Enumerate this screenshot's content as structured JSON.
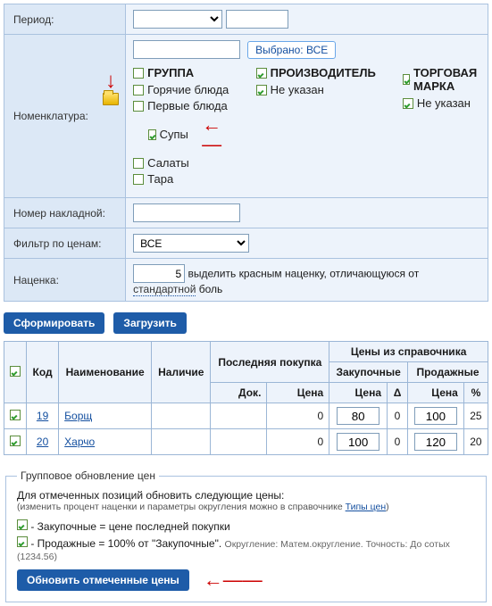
{
  "form": {
    "period_label": "Период:",
    "nomen_label": "Номенклатура:",
    "invoice_label": "Номер накладной:",
    "filter_label": "Фильтр по ценам:",
    "markup_label": "Наценка:",
    "selected_all_btn": "Выбрано: ВСЕ",
    "filter_value": "ВСЕ",
    "markup_value": "5",
    "markup_hint_prefix": "выделить красным наценку, отличающуюся от ",
    "markup_hint_link": "стандартной",
    "markup_hint_suffix": " боль"
  },
  "tree": {
    "col1_header": "ГРУППА",
    "col2_header": "ПРОИЗВОДИТЕЛЬ",
    "col3_header": "ТОРГОВАЯ МАРКА",
    "not_specified": "Не указан",
    "items": {
      "hot": "Горячие блюда",
      "first": "Первые блюда",
      "soups": "Супы",
      "salads": "Салаты",
      "tara": "Тара"
    }
  },
  "buttons": {
    "generate": "Сформировать",
    "load": "Загрузить",
    "update_prices": "Обновить отмеченные цены"
  },
  "table": {
    "h_code": "Код",
    "h_name": "Наименование",
    "h_stock": "Наличие",
    "h_last_purchase": "Последняя покупка",
    "h_ref_prices": "Цены из справочника",
    "h_purchase": "Закупочные",
    "h_sale": "Продажные",
    "h_doc": "Док.",
    "h_price": "Цена",
    "h_delta": "Δ",
    "h_pct": "%",
    "rows": [
      {
        "code": "19",
        "name": "Борщ",
        "last_price": "0",
        "buy_price": "80",
        "delta": "0",
        "sale_price": "100",
        "pct": "25"
      },
      {
        "code": "20",
        "name": "Харчо",
        "last_price": "0",
        "buy_price": "100",
        "delta": "0",
        "sale_price": "120",
        "pct": "20"
      }
    ]
  },
  "group": {
    "legend": "Групповое обновление цен",
    "line1": "Для отмеченных позиций обновить следующие цены:",
    "hint_prefix": "(изменить процент наценки и параметры округления можно в справочнике ",
    "hint_link": "Типы цен",
    "hint_suffix": ")",
    "opt1": " - Закупочные = цене последней покупки",
    "opt2_prefix": " - Продажные = 100% от \"Закупочные\". ",
    "opt2_small": "Округление: Матем.округление. Точность: До сотых (1234.56)"
  }
}
